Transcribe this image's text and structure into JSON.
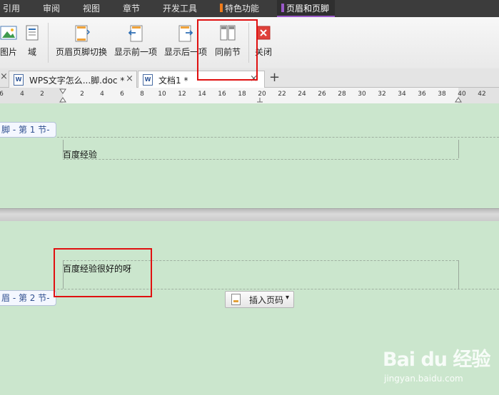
{
  "menu": {
    "items": [
      {
        "label": "引用"
      },
      {
        "label": "审阅"
      },
      {
        "label": "视图"
      },
      {
        "label": "章节"
      },
      {
        "label": "开发工具"
      },
      {
        "label": "特色功能",
        "marker_color": "#f07c1b"
      },
      {
        "label": "页眉和页脚",
        "marker_color": "#9a59c9",
        "active": true
      }
    ]
  },
  "ribbon": {
    "buttons": [
      {
        "label": "图片",
        "icon": "picture-icon"
      },
      {
        "label": "域",
        "icon": "field-icon"
      },
      {
        "label": "页眉页脚切换",
        "icon": "switch-header-footer-icon"
      },
      {
        "label": "显示前一项",
        "icon": "show-previous-icon"
      },
      {
        "label": "显示后一项",
        "icon": "show-next-icon"
      },
      {
        "label": "同前节",
        "icon": "same-as-previous-icon"
      },
      {
        "label": "关闭",
        "icon": "close-icon"
      }
    ]
  },
  "tabs": [
    {
      "title": "WPS文字怎么...脚.doc *",
      "close": "×"
    },
    {
      "title": "文档1 *",
      "close": "×",
      "active": true
    }
  ],
  "new_tab_label": "+",
  "ruler": {
    "ticks": [
      "6",
      "4",
      "2",
      "2",
      "4",
      "6",
      "8",
      "10",
      "12",
      "14",
      "16",
      "18",
      "20",
      "22",
      "24",
      "26",
      "28",
      "30",
      "32",
      "34",
      "36",
      "38",
      "40",
      "42"
    ]
  },
  "sections": {
    "section1_tag": "脚 - 第 1 节-",
    "section1_text": "百度经验",
    "section2_tag": "眉 - 第 2 节-",
    "section2_text": "百度经验很好的呀"
  },
  "insert_page_number": {
    "label": "插入页码",
    "caret": "▾"
  },
  "watermark": {
    "logo": "Bai du 经验",
    "url": "jingyan.baidu.com"
  },
  "colors": {
    "menubar": "#3c3c3c",
    "active_tab_accent": "#9a59c9",
    "page_background": "#cbe6cd",
    "highlight": "#e01010"
  }
}
